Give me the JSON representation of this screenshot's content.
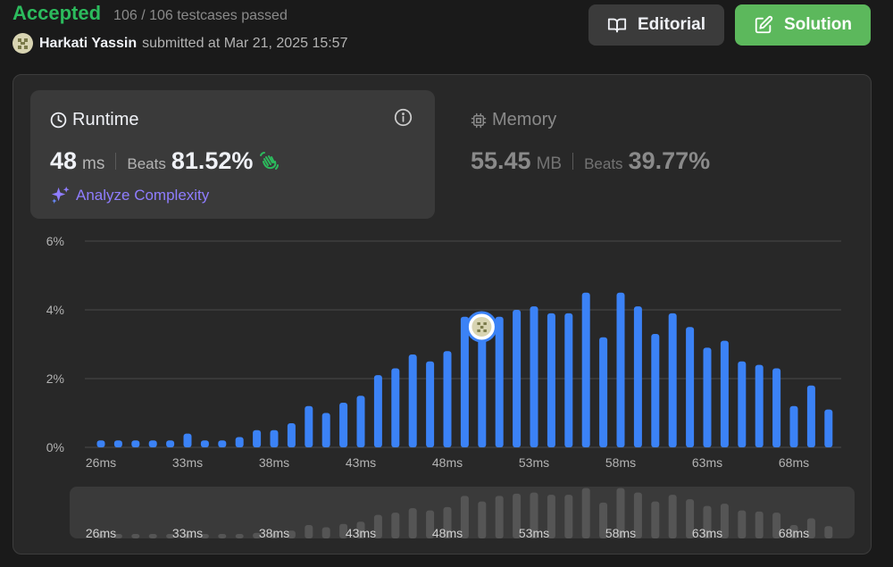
{
  "status": {
    "label": "Accepted",
    "tests": "106 / 106 testcases passed",
    "color": "#2cbb5d"
  },
  "submission": {
    "user": "Harkati Yassin",
    "submitted": "submitted at Mar 21, 2025 15:57"
  },
  "buttons": {
    "editorial": "Editorial",
    "solution": "Solution"
  },
  "runtime": {
    "title": "Runtime",
    "value": "48",
    "unit": "ms",
    "beats_label": "Beats",
    "beats": "81.52%",
    "analyze": "Analyze Complexity"
  },
  "memory": {
    "title": "Memory",
    "value": "55.45",
    "unit": "MB",
    "beats_label": "Beats",
    "beats": "39.77%"
  },
  "icons": [
    "book-open-icon",
    "edit-icon",
    "clock-icon",
    "info-icon",
    "waving-hand-icon",
    "sparkles-icon",
    "cpu-icon"
  ],
  "chart_data": {
    "type": "bar",
    "xlabel": "",
    "ylabel": "",
    "x": [
      26,
      27,
      28,
      29,
      30,
      31,
      32,
      33,
      34,
      35,
      36,
      37,
      38,
      39,
      40,
      41,
      42,
      43,
      44,
      45,
      46,
      47,
      48,
      49,
      50,
      51,
      52,
      53,
      54,
      55,
      56,
      57,
      58,
      59,
      60,
      61,
      62,
      63,
      64,
      65,
      66,
      67,
      68,
      69,
      70
    ],
    "values": [
      0.2,
      0.2,
      0.2,
      0.2,
      0.2,
      0.4,
      0.2,
      0.2,
      0.3,
      0.5,
      0.5,
      0.7,
      1.2,
      1.0,
      1.3,
      1.5,
      2.1,
      2.3,
      2.7,
      2.5,
      2.8,
      3.8,
      3.3,
      3.8,
      4.0,
      4.1,
      3.9,
      3.9,
      4.5,
      3.2,
      4.5,
      4.1,
      3.3,
      3.9,
      3.5,
      2.9,
      3.1,
      2.5,
      2.4,
      2.3,
      1.2,
      1.8,
      1.1,
      0,
      0
    ],
    "highlight_x": 48,
    "ylim": [
      0,
      6
    ],
    "yticks": [
      "0%",
      "2%",
      "4%",
      "6%"
    ],
    "yticks_values": [
      0,
      2,
      4,
      6
    ],
    "xtick_labels": [
      "26ms",
      "33ms",
      "38ms",
      "43ms",
      "48ms",
      "53ms",
      "58ms",
      "63ms",
      "68ms"
    ],
    "xtick_values": [
      26,
      31,
      36,
      41,
      46,
      51,
      56,
      61,
      66
    ],
    "grid": true,
    "bar_color": "#3b82f6",
    "minimap_color": "#555555"
  }
}
